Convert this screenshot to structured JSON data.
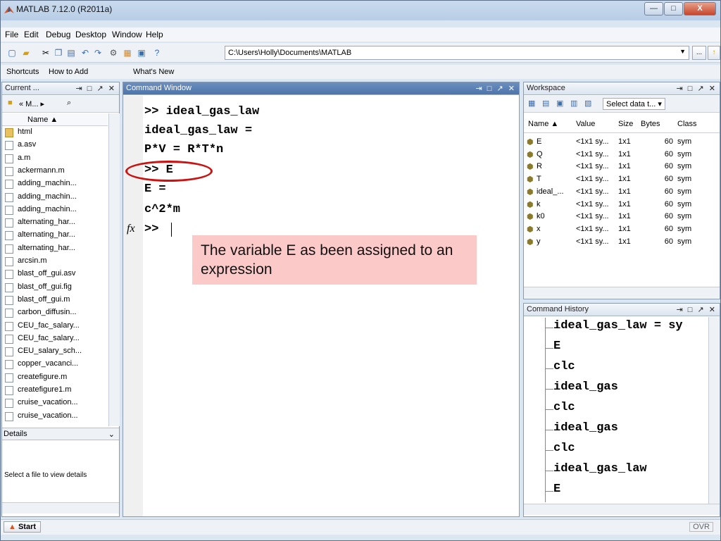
{
  "window": {
    "title": "MATLAB  7.12.0 (R2011a)",
    "min": "—",
    "max": "□",
    "close": "X"
  },
  "menu": [
    "File",
    "Edit",
    "Debug",
    "Desktop",
    "Window",
    "Help"
  ],
  "toolbar": {
    "path": "C:\\Users\\Holly\\Documents\\MATLAB",
    "browse": "...",
    "up": "↑"
  },
  "shortcuts": {
    "label": "Shortcuts",
    "how_to_add": "How to Add",
    "whats_new": "What's New"
  },
  "current_folder": {
    "title": "Current ...",
    "nav": "« M... ▸",
    "col_name": "Name ▲",
    "files": [
      "html",
      "a.asv",
      "a.m",
      "ackermann.m",
      "adding_machin...",
      "adding_machin...",
      "adding_machin...",
      "alternating_har...",
      "alternating_har...",
      "alternating_har...",
      "arcsin.m",
      "blast_off_gui.asv",
      "blast_off_gui.fig",
      "blast_off_gui.m",
      "carbon_diffusin...",
      "CEU_fac_salary...",
      "CEU_fac_salary...",
      "CEU_salary_sch...",
      "copper_vacanci...",
      "createfigure.m",
      "createfigure1.m",
      "cruise_vacation...",
      "cruise_vacation..."
    ],
    "details_label": "Details",
    "details_text": "Select a file to view details"
  },
  "command_window": {
    "title": "Command Window",
    "lines": [
      ">> ideal_gas_law",
      "ideal_gas_law =",
      "P*V = R*T*n",
      ">> E",
      "E =",
      "c^2*m",
      ">> "
    ],
    "fx": "fx"
  },
  "annotation": {
    "text": "The variable E as been assigned to an expression",
    "color": "#fcc9c9",
    "oval_color": "#cc1111"
  },
  "workspace": {
    "title": "Workspace",
    "select_data": "Select data t...",
    "columns": [
      "Name ▲",
      "Value",
      "Size",
      "Bytes",
      "Class"
    ],
    "rows": [
      {
        "name": "E",
        "value": "<1x1 sy...",
        "size": "1x1",
        "bytes": "60",
        "class": "sym"
      },
      {
        "name": "Q",
        "value": "<1x1 sy...",
        "size": "1x1",
        "bytes": "60",
        "class": "sym"
      },
      {
        "name": "R",
        "value": "<1x1 sy...",
        "size": "1x1",
        "bytes": "60",
        "class": "sym"
      },
      {
        "name": "T",
        "value": "<1x1 sy...",
        "size": "1x1",
        "bytes": "60",
        "class": "sym"
      },
      {
        "name": "ideal_...",
        "value": "<1x1 sy...",
        "size": "1x1",
        "bytes": "60",
        "class": "sym"
      },
      {
        "name": "k",
        "value": "<1x1 sy...",
        "size": "1x1",
        "bytes": "60",
        "class": "sym"
      },
      {
        "name": "k0",
        "value": "<1x1 sy...",
        "size": "1x1",
        "bytes": "60",
        "class": "sym"
      },
      {
        "name": "x",
        "value": "<1x1 sy...",
        "size": "1x1",
        "bytes": "60",
        "class": "sym"
      },
      {
        "name": "y",
        "value": "<1x1 sy...",
        "size": "1x1",
        "bytes": "60",
        "class": "sym"
      }
    ]
  },
  "history": {
    "title": "Command History",
    "items": [
      "ideal_gas_law = sy",
      "E",
      "clc",
      "ideal_gas",
      "clc",
      "ideal_gas",
      "clc",
      "ideal_gas_law",
      "E"
    ]
  },
  "status": {
    "start": "Start",
    "ovr": "OVR"
  }
}
